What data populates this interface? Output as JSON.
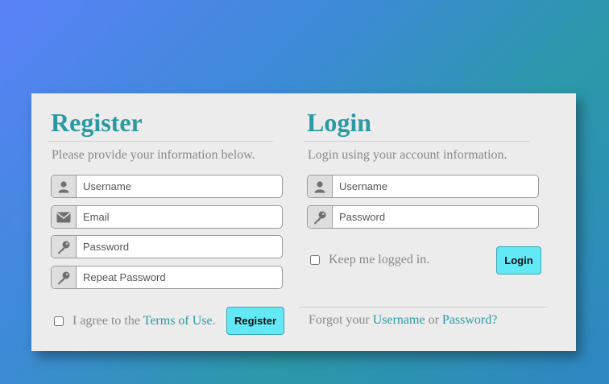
{
  "register": {
    "title": "Register",
    "subtitle": "Please provide your information below.",
    "username_placeholder": "Username",
    "email_placeholder": "Email",
    "password_placeholder": "Password",
    "repeat_password_placeholder": "Repeat Password",
    "agree_prefix": "I agree to the",
    "terms_link": "Terms of Use",
    "agree_suffix": ".",
    "button_label": "Register"
  },
  "login": {
    "title": "Login",
    "subtitle": "Login using your account information.",
    "username_placeholder": "Username",
    "password_placeholder": "Password",
    "keep_logged_label": "Keep me logged in.",
    "button_label": "Login",
    "forgot_prefix": "Forgot your",
    "username_link": "Username",
    "or_text": "or",
    "password_link": "Password?"
  },
  "icons": {
    "user": "user-icon",
    "email": "envelope-icon",
    "password": "key-icon"
  },
  "colors": {
    "accent": "#2b99a3",
    "button": "#63e8f5",
    "panel": "#ececec",
    "muted_text": "#8a8a8a"
  }
}
